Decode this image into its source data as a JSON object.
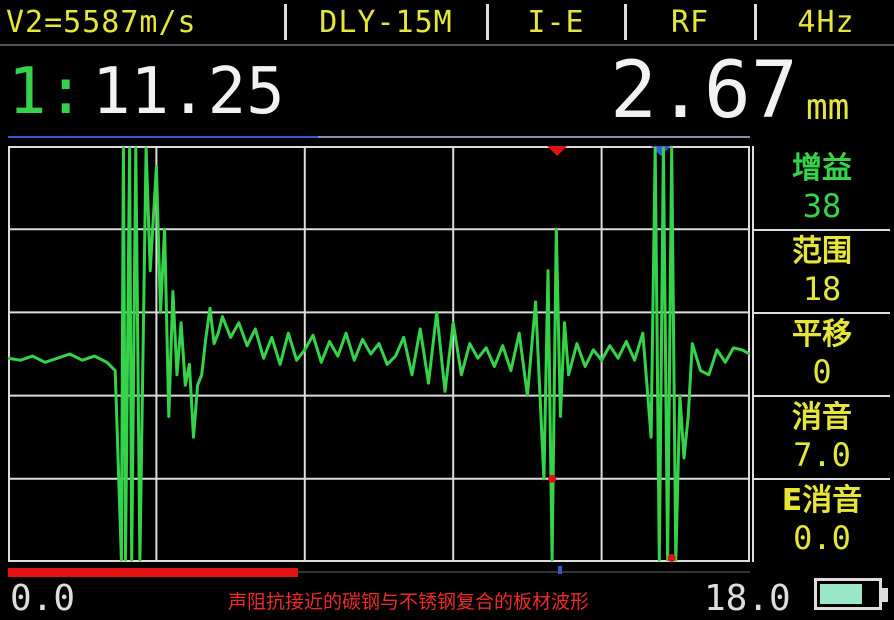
{
  "status_bar": {
    "velocity": "V2=5587m/s",
    "probe": "DLY-15M",
    "mode": "I-E",
    "signal": "RF",
    "rep_rate": "4Hz"
  },
  "readout": {
    "channel": "1:",
    "time": "11.25",
    "thickness": "2.67",
    "unit": "mm"
  },
  "sidebar": {
    "items": [
      {
        "label": "增益",
        "value": "38"
      },
      {
        "label": "范围",
        "value": "18"
      },
      {
        "label": "平移",
        "value": "0"
      },
      {
        "label": "消音",
        "value": "7.0"
      },
      {
        "label": "E消音",
        "value": "0.0"
      }
    ]
  },
  "axis": {
    "start": "0.0",
    "end": "18.0"
  },
  "caption": "声阻抗接近的碳钢与不锈钢复合的板材波形",
  "battery": {
    "level": 0.75
  },
  "gates": {
    "red_marker": 0.74,
    "blue_marker": 0.88
  },
  "colors": {
    "trace": "#35d34a",
    "accent": "#e6e63a",
    "gate_red": "#e31212",
    "gate_blue": "#3357d6"
  },
  "chart_data": {
    "type": "line",
    "xlim": [
      0,
      18
    ],
    "ylim": [
      -100,
      100
    ],
    "grid": true,
    "series": [
      {
        "x": [
          0,
          0.3,
          0.6,
          0.9,
          1.2,
          1.5,
          1.8,
          2.1,
          2.4,
          2.6,
          2.75,
          2.8,
          2.85,
          2.95,
          3.0,
          3.1,
          3.2,
          3.35,
          3.45,
          3.6,
          3.7,
          3.8,
          3.9,
          4.0,
          4.1,
          4.2,
          4.3,
          4.4,
          4.5,
          4.6,
          4.7,
          4.8,
          4.9,
          5.0,
          5.1,
          5.2,
          5.4,
          5.6,
          5.8,
          6.0,
          6.2,
          6.4,
          6.6,
          6.8,
          7.0,
          7.2,
          7.4,
          7.6,
          7.8,
          8.0,
          8.2,
          8.4,
          8.6,
          8.8,
          9.0,
          9.2,
          9.4,
          9.6,
          9.8,
          10.0,
          10.2,
          10.4,
          10.6,
          10.8,
          11.0,
          11.2,
          11.4,
          11.6,
          11.8,
          12.0,
          12.2,
          12.4,
          12.6,
          12.8,
          13.0,
          13.1,
          13.2,
          13.3,
          13.4,
          13.5,
          13.6,
          13.8,
          14.0,
          14.2,
          14.4,
          14.6,
          14.8,
          15.0,
          15.2,
          15.4,
          15.6,
          15.7,
          15.8,
          15.9,
          16.0,
          16.1,
          16.2,
          16.3,
          16.4,
          16.5,
          16.6,
          16.8,
          17.0,
          17.2,
          17.4,
          17.6,
          17.8,
          18.0
        ],
        "y": [
          -2,
          -3,
          -1,
          -4,
          -2,
          0,
          -3,
          -1,
          -4,
          -8,
          -100,
          100,
          -100,
          100,
          -100,
          100,
          -100,
          100,
          40,
          90,
          20,
          60,
          -30,
          30,
          -10,
          15,
          -15,
          -5,
          -40,
          -15,
          -10,
          8,
          22,
          5,
          10,
          18,
          8,
          15,
          4,
          12,
          -2,
          8,
          -5,
          10,
          -3,
          2,
          9,
          -4,
          6,
          -1,
          10,
          -3,
          7,
          0,
          5,
          -5,
          -1,
          8,
          -10,
          12,
          -14,
          20,
          -18,
          15,
          -10,
          5,
          -2,
          3,
          -6,
          4,
          -8,
          10,
          -20,
          25,
          -60,
          40,
          -100,
          60,
          -30,
          15,
          -10,
          5,
          -6,
          2,
          -3,
          4,
          -2,
          6,
          -3,
          10,
          -40,
          100,
          -100,
          100,
          -100,
          100,
          -100,
          -20,
          -50,
          -30,
          5,
          -8,
          -10,
          2,
          -4,
          3,
          2,
          0
        ]
      }
    ]
  }
}
